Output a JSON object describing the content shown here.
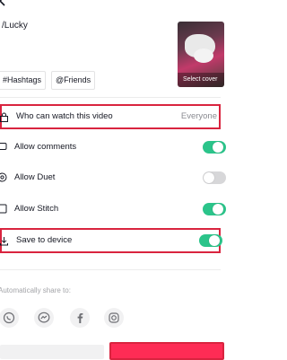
{
  "caption": {
    "text": "/Lucky"
  },
  "cover": {
    "label": "Select cover"
  },
  "tags": [
    {
      "label": "Hashtags",
      "icon": "hashtag-icon"
    },
    {
      "label": "Friends",
      "icon": "at-mention-icon"
    }
  ],
  "settings": {
    "who_can_watch": {
      "label": "Who can watch this video",
      "value": "Everyone",
      "icon": "lock-icon"
    },
    "allow_comments": {
      "label": "Allow comments",
      "icon": "comment-icon",
      "enabled": true
    },
    "allow_duet": {
      "label": "Allow Duet",
      "icon": "duet-icon",
      "enabled": false
    },
    "allow_stitch": {
      "label": "Allow Stitch",
      "icon": "stitch-icon",
      "enabled": true
    },
    "save_to_device": {
      "label": "Save to device",
      "icon": "download-icon",
      "enabled": true
    }
  },
  "share": {
    "label": "Automatically share to:",
    "targets": [
      "whatsapp-icon",
      "messenger-icon",
      "facebook-icon",
      "instagram-icon"
    ]
  },
  "colors": {
    "accent": "#fe2c55",
    "toggle_on": "#2bc48a",
    "highlight": "#d9243f"
  }
}
